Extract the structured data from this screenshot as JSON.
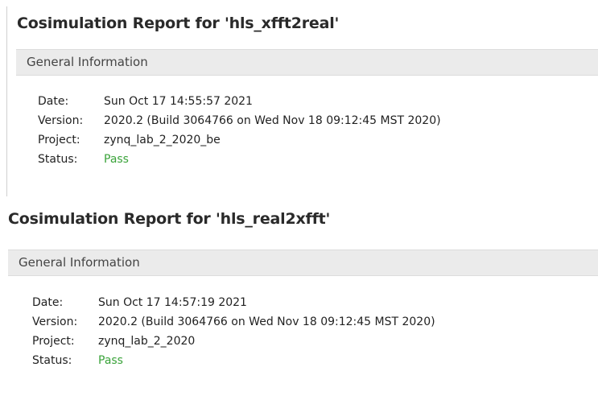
{
  "reports": [
    {
      "title": "Cosimulation Report for 'hls_xfft2real'",
      "section": "General Information",
      "rows": {
        "date_key": "Date:",
        "date_val": "Sun Oct 17 14:55:57 2021",
        "version_key": "Version:",
        "version_val": "2020.2 (Build 3064766 on Wed Nov 18 09:12:45 MST 2020)",
        "project_key": "Project:",
        "project_val": "zynq_lab_2_2020_be",
        "status_key": "Status:",
        "status_val": "Pass"
      }
    },
    {
      "title": "Cosimulation Report for 'hls_real2xfft'",
      "section": "General Information",
      "rows": {
        "date_key": "Date:",
        "date_val": "Sun Oct 17 14:57:19 2021",
        "version_key": "Version:",
        "version_val": "2020.2 (Build 3064766 on Wed Nov 18 09:12:45 MST 2020)",
        "project_key": "Project:",
        "project_val": "zynq_lab_2_2020",
        "status_key": "Status:",
        "status_val": "Pass"
      }
    }
  ],
  "colors": {
    "pass": "#3aa33a",
    "section_bar": "#ebebeb"
  }
}
